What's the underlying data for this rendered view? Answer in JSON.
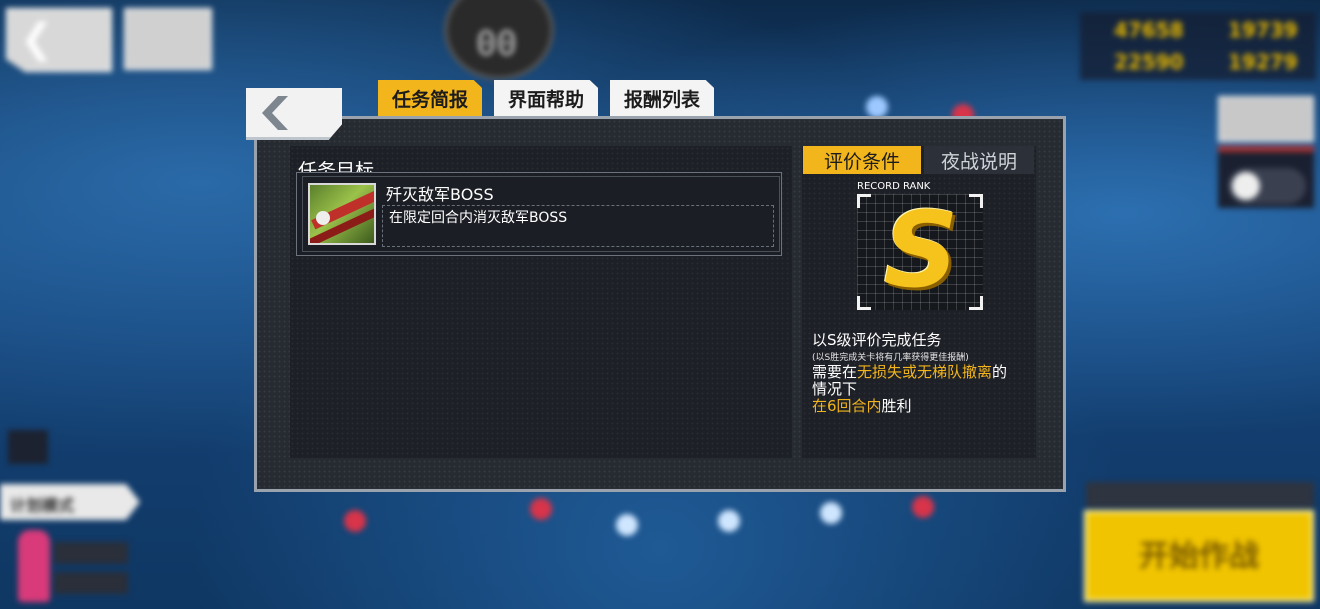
{
  "modal": {
    "tabs": [
      {
        "label": "任务简报",
        "active": true
      },
      {
        "label": "界面帮助",
        "active": false
      },
      {
        "label": "报酬列表",
        "active": false
      }
    ],
    "objective_title": "任务目标",
    "objective": {
      "name": "歼灭敌军BOSS",
      "description": "在限定回合内消灭敌军BOSS"
    },
    "right_tabs": [
      {
        "label": "评价条件",
        "active": true
      },
      {
        "label": "夜战说明",
        "active": false
      }
    ],
    "rank": {
      "label": "RECORD RANK",
      "grade": "S"
    },
    "conditions": {
      "line1": "以S级评价完成任务",
      "note": "(以S胜完成关卡将有几率获得更佳报酬)",
      "line2_pre": "需要在",
      "line2_hl": "无损失或无梯队撤离",
      "line2_post": "的",
      "line3": "情况下",
      "line4_hl": "在6回合内",
      "line4_post": "胜利"
    }
  },
  "background": {
    "resources": [
      "47658",
      "19739",
      "22590",
      "19279"
    ],
    "turn": "00",
    "plan_mode": "计划模式",
    "start_button": "开始作战"
  },
  "colors": {
    "accent": "#f3b51c",
    "panel": "#262a31",
    "border": "#9aa3ad"
  }
}
